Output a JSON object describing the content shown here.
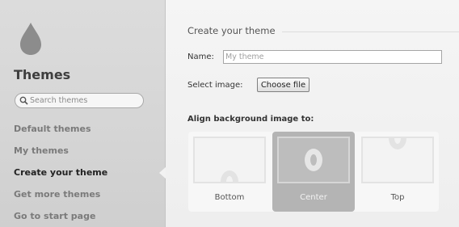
{
  "sidebar": {
    "title": "Themes",
    "search_placeholder": "Search themes",
    "items": [
      {
        "label": "Default themes",
        "active": false
      },
      {
        "label": "My themes",
        "active": false
      },
      {
        "label": "Create your theme",
        "active": true
      },
      {
        "label": "Get more themes",
        "active": false
      },
      {
        "label": "Go to start page",
        "active": false
      }
    ]
  },
  "main": {
    "section_title": "Create your theme",
    "name_label": "Name:",
    "name_value": "",
    "name_placeholder": "My theme",
    "image_label": "Select image:",
    "choose_button_label": "Choose file",
    "align_title": "Align background image to:",
    "align_options": [
      {
        "label": "Bottom",
        "selected": false
      },
      {
        "label": "Center",
        "selected": true
      },
      {
        "label": "Top",
        "selected": false
      }
    ]
  },
  "icons": {
    "logo": "drop-icon",
    "search": "magnifier-icon",
    "thumbnail_glyph": "o-icon"
  },
  "colors": {
    "sidebar_bg": "#d8d8d8",
    "active_nav_text": "#222222",
    "inactive_nav_text": "#7a7a7a",
    "selected_option_bg": "#b4b4b4",
    "page_bg": "#f1f1f1"
  }
}
